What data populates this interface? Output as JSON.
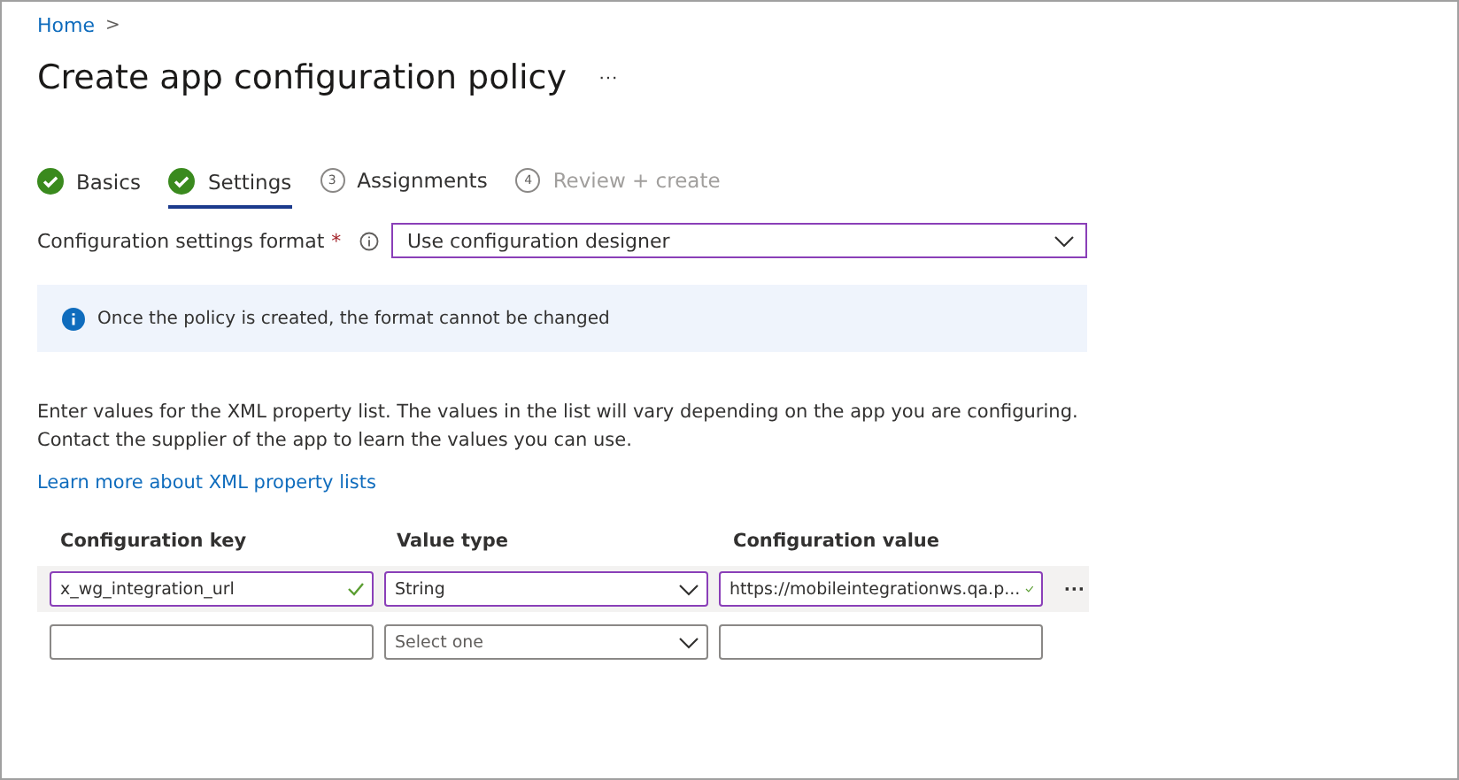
{
  "breadcrumb": {
    "items": [
      "Home"
    ],
    "separator": ">"
  },
  "title": "Create app configuration policy",
  "title_menu": "···",
  "steps": [
    {
      "kind": "done",
      "label": "Basics",
      "selected": false,
      "disabled": false
    },
    {
      "kind": "done",
      "label": "Settings",
      "selected": true,
      "disabled": false
    },
    {
      "kind": "numbered",
      "number": "3",
      "label": "Assignments",
      "selected": false,
      "disabled": false
    },
    {
      "kind": "numbered",
      "number": "4",
      "label": "Review + create",
      "selected": false,
      "disabled": true
    }
  ],
  "format": {
    "label": "Configuration settings format",
    "required": "*",
    "value": "Use configuration designer"
  },
  "info": "Once the policy is created, the format cannot be changed",
  "description": "Enter values for the XML property list. The values in the list will vary depending on the app you are configuring. Contact the supplier of the app to learn the values you can use.",
  "link": "Learn more about XML property lists",
  "table": {
    "columns": [
      "Configuration key",
      "Value type",
      "Configuration value"
    ],
    "rows": [
      {
        "selected": true,
        "key": {
          "value": "x_wg_integration_url",
          "valid": true
        },
        "type": {
          "value": "String"
        },
        "value": {
          "value": "https://mobileintegrationws.qa.p...",
          "valid": true
        },
        "more": "···"
      },
      {
        "selected": false,
        "key": {
          "valid": false
        },
        "type": {
          "placeholder": "Select one"
        },
        "value": {
          "valid": false
        }
      }
    ]
  }
}
